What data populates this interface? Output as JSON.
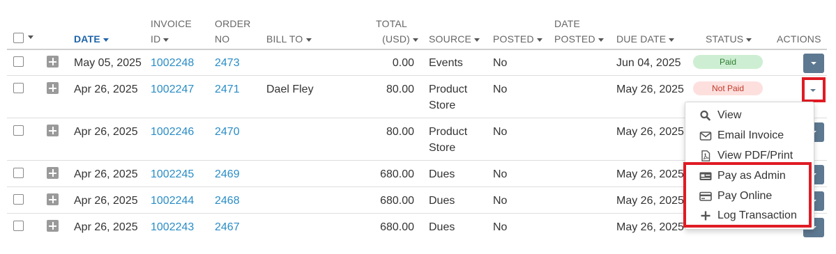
{
  "headers": {
    "date": "DATE",
    "invoice_id_line1": "INVOICE",
    "invoice_id_line2": "ID",
    "order_no_line1": "ORDER",
    "order_no_line2": "NO",
    "bill_to": "BILL TO",
    "total_line1": "TOTAL",
    "total_line2": "(USD)",
    "source": "SOURCE",
    "posted": "POSTED",
    "date_posted_line1": "DATE",
    "date_posted_line2": "POSTED",
    "due_date": "DUE DATE",
    "status": "STATUS",
    "actions": "ACTIONS"
  },
  "rows": [
    {
      "date": "May 05, 2025",
      "invoice_id": "1002248",
      "order_no": "2473",
      "bill_to": "",
      "total": "0.00",
      "source_line1": "Events",
      "source_line2": "",
      "posted": "No",
      "due_date": "Jun 04, 2025",
      "status": "Paid"
    },
    {
      "date": "Apr 26, 2025",
      "invoice_id": "1002247",
      "order_no": "2471",
      "bill_to": "Dael Fley",
      "total": "80.00",
      "source_line1": "Product",
      "source_line2": "Store",
      "posted": "No",
      "due_date": "May 26, 2025",
      "status": "Not Paid"
    },
    {
      "date": "Apr 26, 2025",
      "invoice_id": "1002246",
      "order_no": "2470",
      "bill_to": "",
      "total": "80.00",
      "source_line1": "Product",
      "source_line2": "Store",
      "posted": "No",
      "due_date": "May 26, 2025",
      "status": ""
    },
    {
      "date": "Apr 26, 2025",
      "invoice_id": "1002245",
      "order_no": "2469",
      "bill_to": "",
      "total": "680.00",
      "source_line1": "Dues",
      "source_line2": "",
      "posted": "No",
      "due_date": "May 26, 2025",
      "status": ""
    },
    {
      "date": "Apr 26, 2025",
      "invoice_id": "1002244",
      "order_no": "2468",
      "bill_to": "",
      "total": "680.00",
      "source_line1": "Dues",
      "source_line2": "",
      "posted": "No",
      "due_date": "May 26, 2025",
      "status": ""
    },
    {
      "date": "Apr 26, 2025",
      "invoice_id": "1002243",
      "order_no": "2467",
      "bill_to": "",
      "total": "680.00",
      "source_line1": "Dues",
      "source_line2": "",
      "posted": "No",
      "due_date": "May 26, 2025",
      "status": ""
    }
  ],
  "dropdown_menu": {
    "items": [
      {
        "label": "View",
        "icon": "search-icon"
      },
      {
        "label": "Email Invoice",
        "icon": "envelope-icon"
      },
      {
        "label": "View PDF/Print",
        "icon": "pdf-file-icon"
      },
      {
        "label": "Pay as Admin",
        "icon": "admin-card-icon"
      },
      {
        "label": "Pay Online",
        "icon": "credit-card-icon"
      },
      {
        "label": "Log Transaction",
        "icon": "plus-icon"
      }
    ]
  },
  "colors": {
    "link": "#2a8dc6",
    "active_header": "#1e63a8",
    "action_button": "#5d7891",
    "paid_badge_bg": "#cdeed2",
    "not_paid_badge_bg": "#fde0de",
    "highlight_border": "#e01b24"
  }
}
